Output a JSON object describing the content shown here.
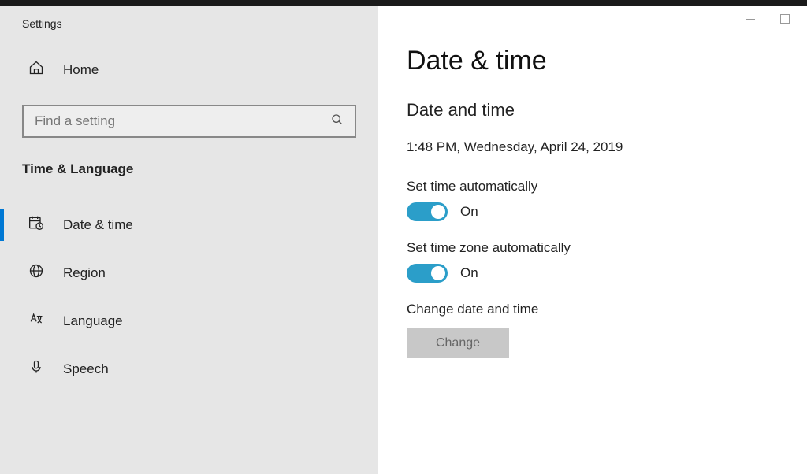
{
  "window": {
    "title": "Settings"
  },
  "sidebar": {
    "home_label": "Home",
    "search_placeholder": "Find a setting",
    "section_title": "Time & Language",
    "items": [
      {
        "label": "Date & time",
        "active": true
      },
      {
        "label": "Region",
        "active": false
      },
      {
        "label": "Language",
        "active": false
      },
      {
        "label": "Speech",
        "active": false
      }
    ]
  },
  "main": {
    "heading": "Date & time",
    "sub_heading": "Date and time",
    "current_datetime": "1:48 PM, Wednesday, April 24, 2019",
    "set_time_auto": {
      "label": "Set time automatically",
      "state": "On"
    },
    "set_tz_auto": {
      "label": "Set time zone automatically",
      "state": "On"
    },
    "change_section": {
      "label": "Change date and time",
      "button": "Change"
    }
  }
}
